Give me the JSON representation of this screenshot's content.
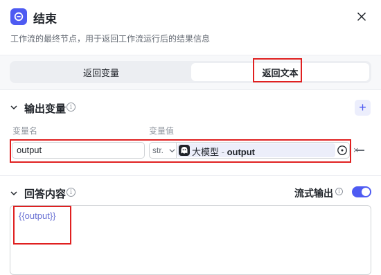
{
  "header": {
    "title": "结束",
    "description": "工作流的最终节点，用于返回工作流运行后的结果信息"
  },
  "tabs": [
    {
      "label": "返回变量",
      "selected": false
    },
    {
      "label": "返回文本",
      "selected": true
    }
  ],
  "output_section": {
    "title": "输出变量",
    "col_name": "变量名",
    "col_value": "变量值",
    "rows": [
      {
        "name": "output",
        "type": "str.",
        "ref_source": "大模型",
        "ref_sep": " - ",
        "ref_var": "output",
        "clear": "×"
      }
    ]
  },
  "answer_section": {
    "title": "回答内容",
    "stream_label": "流式输出",
    "stream_on": true,
    "content": "{{output}}"
  },
  "colors": {
    "accent": "#4e5bf2",
    "highlight_box": "#e02020"
  }
}
